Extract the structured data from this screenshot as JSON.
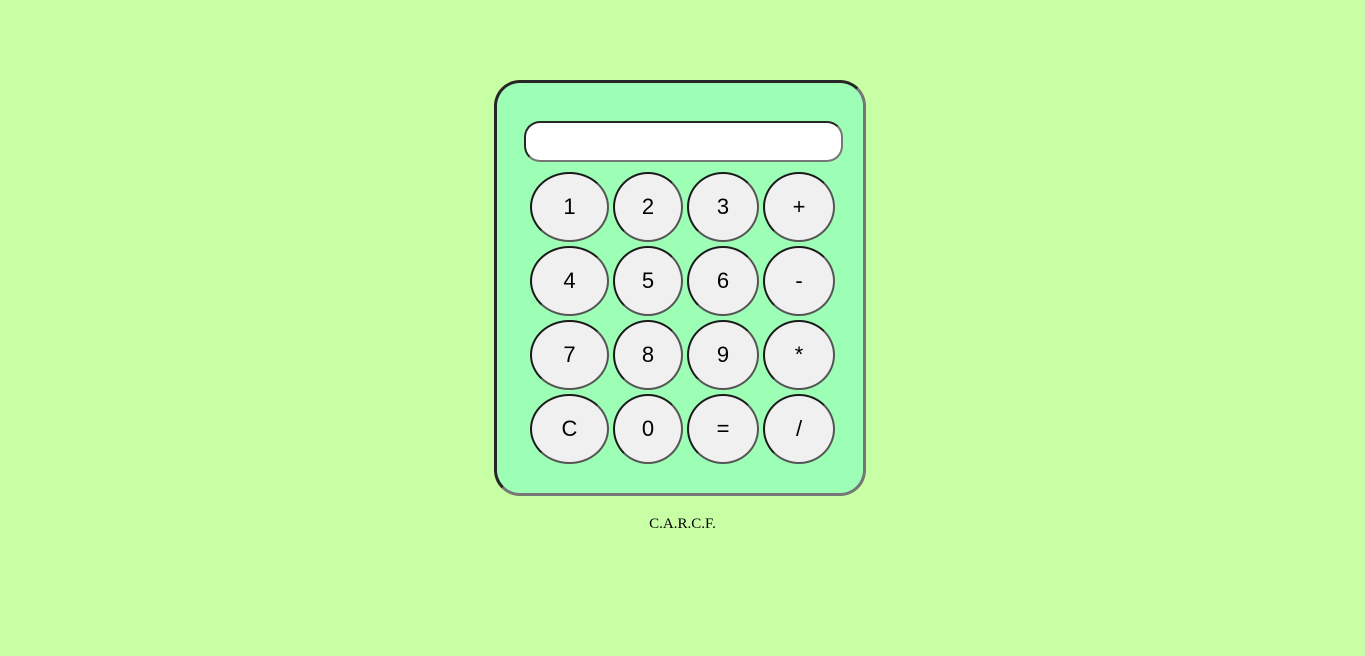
{
  "calculator": {
    "display": {
      "value": "",
      "placeholder": ""
    },
    "keys": {
      "one": "1",
      "two": "2",
      "three": "3",
      "plus": "+",
      "four": "4",
      "five": "5",
      "six": "6",
      "minus": "-",
      "seven": "7",
      "eight": "8",
      "nine": "9",
      "multiply": "*",
      "clear": "C",
      "zero": "0",
      "equals": "=",
      "divide": "/"
    },
    "colors": {
      "page_background": "#c8ffa5",
      "body_background": "#9cffb5",
      "key_background": "#f0f0f0",
      "display_background": "#ffffff"
    }
  },
  "footer": {
    "credit": "C.A.R.C.F."
  }
}
